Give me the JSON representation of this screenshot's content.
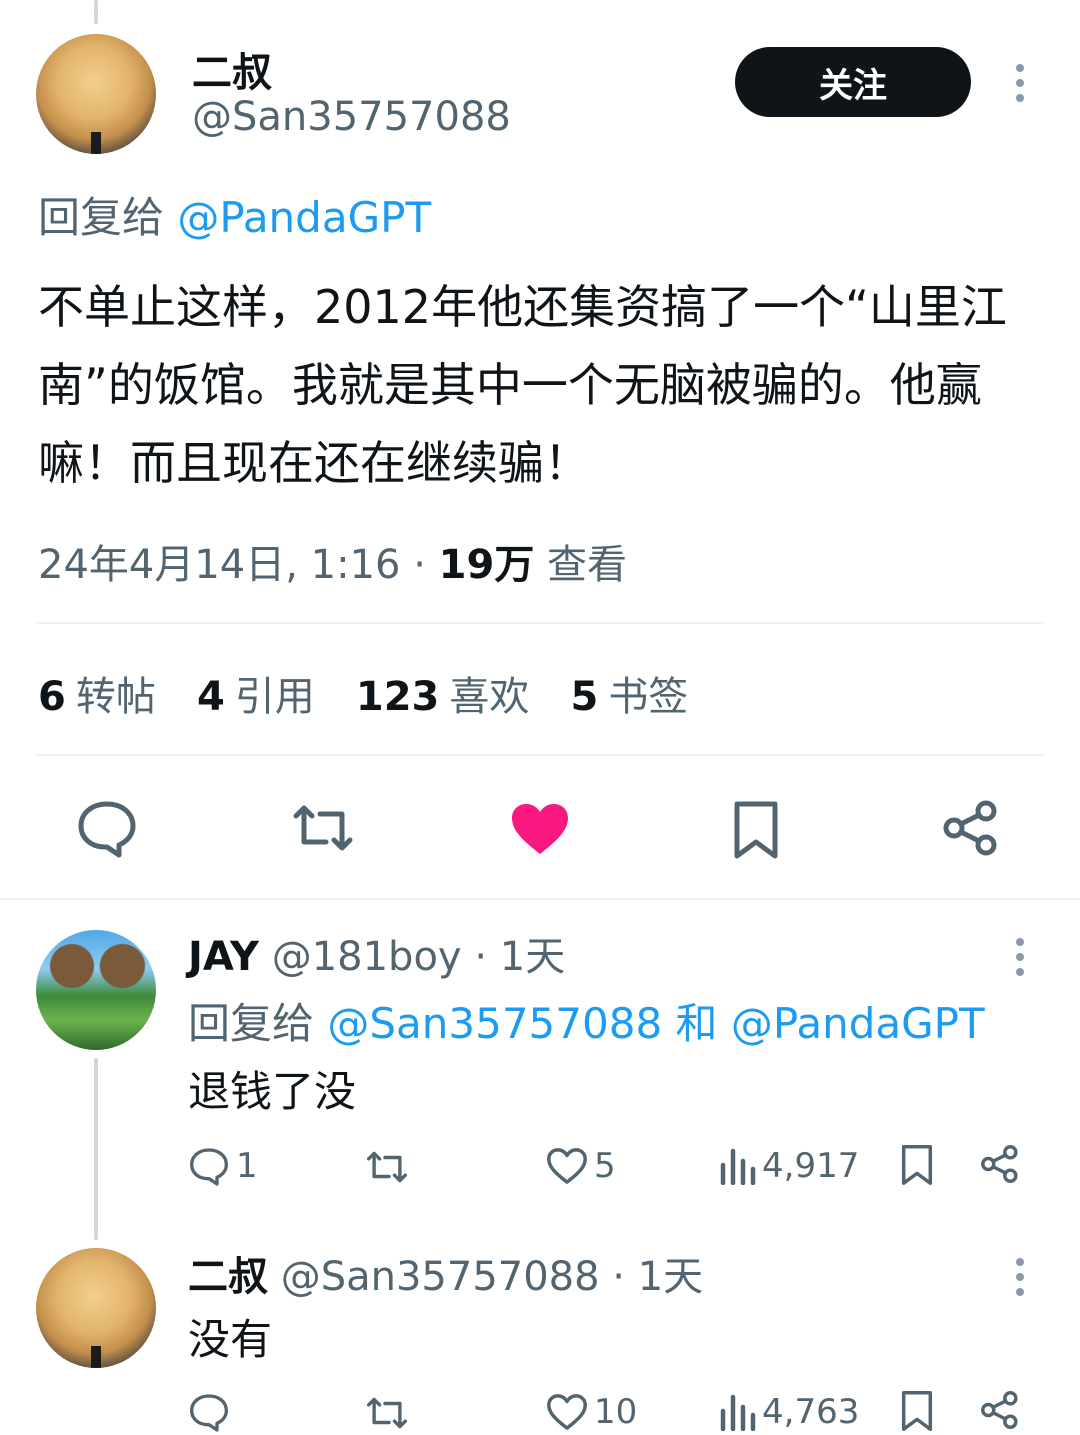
{
  "main_tweet": {
    "author": {
      "name": "二叔",
      "handle": "@San35757088"
    },
    "follow_label": "关注",
    "reply_prefix": "回复给",
    "reply_to": "@PandaGPT",
    "text": "不单止这样，2012年他还集资搞了一个“山里江南”的饭馆。我就是其中一个无脑被骗的。他赢嘛！而且现在还在继续骗！",
    "timestamp": "24年4月14日, 1:16",
    "separator": "·",
    "views_count": "19万",
    "views_label": "查看",
    "stats": [
      {
        "count": "6",
        "label": "转帖"
      },
      {
        "count": "4",
        "label": "引用"
      },
      {
        "count": "123",
        "label": "喜欢"
      },
      {
        "count": "5",
        "label": "书签"
      }
    ],
    "like_color": "#f91880"
  },
  "replies": [
    {
      "author": {
        "name": "JAY",
        "handle": "@181boy"
      },
      "time": "· 1天",
      "reply_prefix": "回复给",
      "reply_to_1": "@San35757088",
      "conj": "和",
      "reply_to_2": "@PandaGPT",
      "text": "退钱了没",
      "reply_count": "1",
      "like_count": "5",
      "view_count": "4,917"
    },
    {
      "author": {
        "name": "二叔",
        "handle": "@San35757088"
      },
      "time": "· 1天",
      "text": "没有",
      "like_count": "10",
      "view_count": "4,763"
    }
  ]
}
